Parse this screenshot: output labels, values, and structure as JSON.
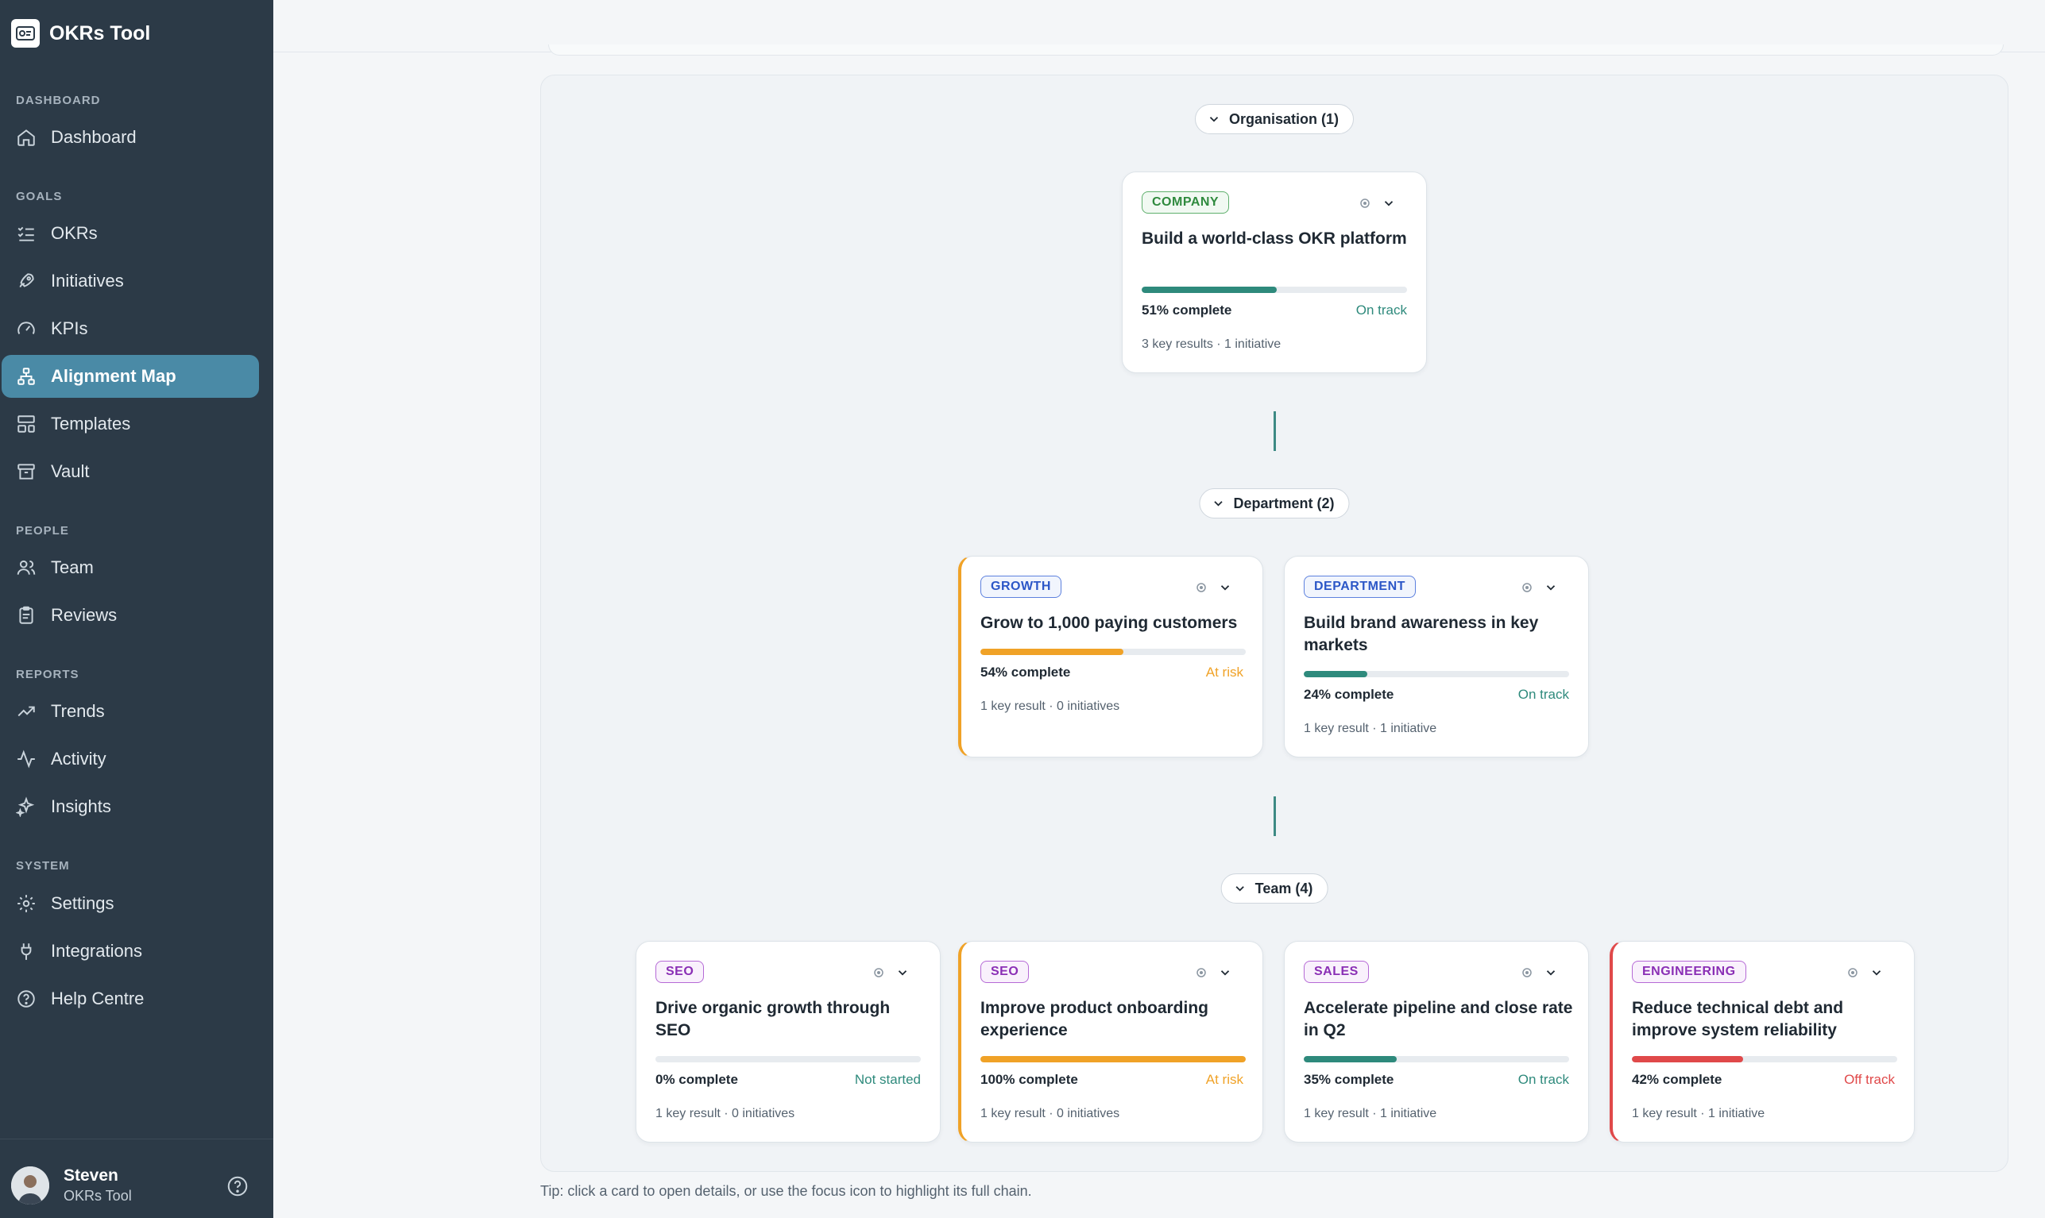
{
  "app": {
    "name": "OKRs Tool"
  },
  "nav": {
    "sections": {
      "dashboard": "DASHBOARD",
      "goals": "GOALS",
      "people": "PEOPLE",
      "reports": "REPORTS",
      "system": "SYSTEM"
    },
    "items": {
      "dashboard": "Dashboard",
      "okrs": "OKRs",
      "initiatives": "Initiatives",
      "kpis": "KPIs",
      "alignment_map": "Alignment Map",
      "templates": "Templates",
      "vault": "Vault",
      "team": "Team",
      "reviews": "Reviews",
      "trends": "Trends",
      "activity": "Activity",
      "insights": "Insights",
      "settings": "Settings",
      "integrations": "Integrations",
      "help_centre": "Help Centre"
    },
    "active": "alignment_map"
  },
  "user": {
    "name": "Steven",
    "org": "OKRs Tool"
  },
  "levels": {
    "organisation": "Organisation (1)",
    "department": "Department (2)",
    "team": "Team (4)"
  },
  "colors": {
    "on_track": "#2e8a7c",
    "at_risk": "#f0a227",
    "off_track": "#e0494a",
    "not_started": "#2e8a7c",
    "accent": "#4a8aa6"
  },
  "cards": {
    "company": {
      "tag": "COMPANY",
      "title": "Build a world-class OKR platform",
      "progress": 51,
      "pct": "51% complete",
      "status": "On track",
      "meta": "3 key results · 1 initiative"
    },
    "growth": {
      "tag": "GROWTH",
      "title": "Grow to 1,000 paying customers",
      "progress": 54,
      "pct": "54% complete",
      "status": "At risk",
      "meta": "1 key result · 0 initiatives"
    },
    "department": {
      "tag": "DEPARTMENT",
      "title": "Build brand awareness in key markets",
      "progress": 24,
      "pct": "24% complete",
      "status": "On track",
      "meta": "1 key result · 1 initiative"
    },
    "seo1": {
      "tag": "SEO",
      "title": "Drive organic growth through SEO",
      "progress": 0,
      "pct": "0% complete",
      "status": "Not started",
      "meta": "1 key result · 0 initiatives"
    },
    "seo2": {
      "tag": "SEO",
      "title": "Improve product onboarding experience",
      "progress": 100,
      "pct": "100% complete",
      "status": "At risk",
      "meta": "1 key result · 0 initiatives"
    },
    "sales": {
      "tag": "SALES",
      "title": "Accelerate pipeline and close rate in Q2",
      "progress": 35,
      "pct": "35% complete",
      "status": "On track",
      "meta": "1 key result · 1 initiative"
    },
    "engineering": {
      "tag": "ENGINEERING",
      "title": "Reduce technical debt and improve system reliability",
      "progress": 42,
      "pct": "42% complete",
      "status": "Off track",
      "meta": "1 key result · 1 initiative"
    }
  },
  "tip": "Tip: click a card to open details, or use the focus icon to highlight its full chain."
}
